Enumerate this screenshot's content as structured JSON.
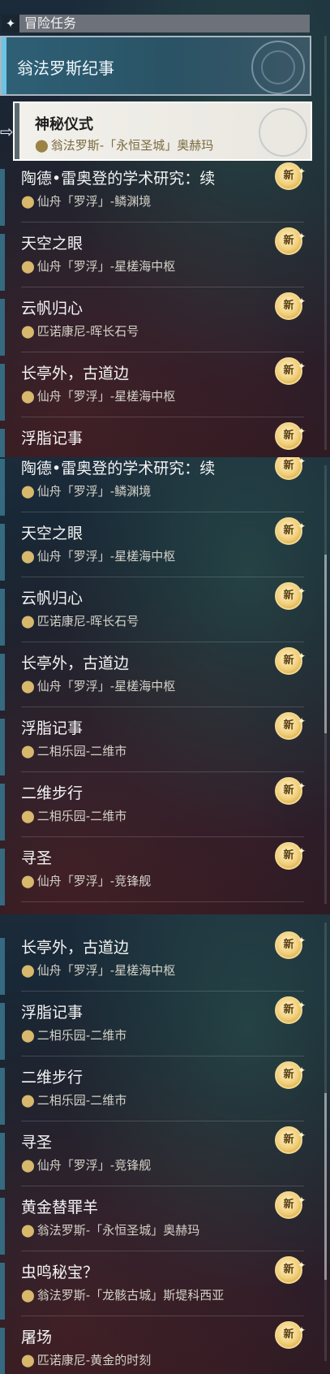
{
  "header": {
    "icon": "four-point-star-icon",
    "title": "冒险任务"
  },
  "region": {
    "title": "翁法罗斯纪事"
  },
  "selected": {
    "title": "神秘仪式",
    "location": "翁法罗斯-「永恒圣城」奥赫玛"
  },
  "badge_label": "新",
  "panel1": {
    "items": [
      {
        "title": "陶德•雷奥登的学术研究：续",
        "location": "仙舟「罗浮」-鳞渊境"
      },
      {
        "title": "天空之眼",
        "location": "仙舟「罗浮」-星槎海中枢"
      },
      {
        "title": "云帆归心",
        "location": "匹诺康尼-晖长石号"
      },
      {
        "title": "长亭外，古道边",
        "location": "仙舟「罗浮」-星槎海中枢"
      },
      {
        "title": "浮脂记事",
        "location": ""
      }
    ]
  },
  "panel2": {
    "items": [
      {
        "title": "陶德•雷奥登的学术研究：续",
        "location": "仙舟「罗浮」-鳞渊境"
      },
      {
        "title": "天空之眼",
        "location": "仙舟「罗浮」-星槎海中枢"
      },
      {
        "title": "云帆归心",
        "location": "匹诺康尼-晖长石号"
      },
      {
        "title": "长亭外，古道边",
        "location": "仙舟「罗浮」-星槎海中枢"
      },
      {
        "title": "浮脂记事",
        "location": "二相乐园-二维市"
      },
      {
        "title": "二维步行",
        "location": "二相乐园-二维市"
      },
      {
        "title": "寻圣",
        "location": "仙舟「罗浮」-竞锋舰"
      }
    ]
  },
  "panel3": {
    "items": [
      {
        "title": "长亭外，古道边",
        "location": "仙舟「罗浮」-星槎海中枢"
      },
      {
        "title": "浮脂记事",
        "location": "二相乐园-二维市"
      },
      {
        "title": "二维步行",
        "location": "二相乐园-二维市"
      },
      {
        "title": "寻圣",
        "location": "仙舟「罗浮」-竞锋舰"
      },
      {
        "title": "黄金替罪羊",
        "location": "翁法罗斯-「永恒圣城」奥赫玛"
      },
      {
        "title": "虫鸣秘宝？",
        "location": "翁法罗斯-「龙骸古城」斯堤科西亚"
      },
      {
        "title": "屠场",
        "location": "匹诺康尼-黄金的时刻"
      }
    ]
  },
  "colors": {
    "accent": "#6cc3e4",
    "badge_gold": "#f1cf7a",
    "pin_gold": "#d7b86c"
  }
}
